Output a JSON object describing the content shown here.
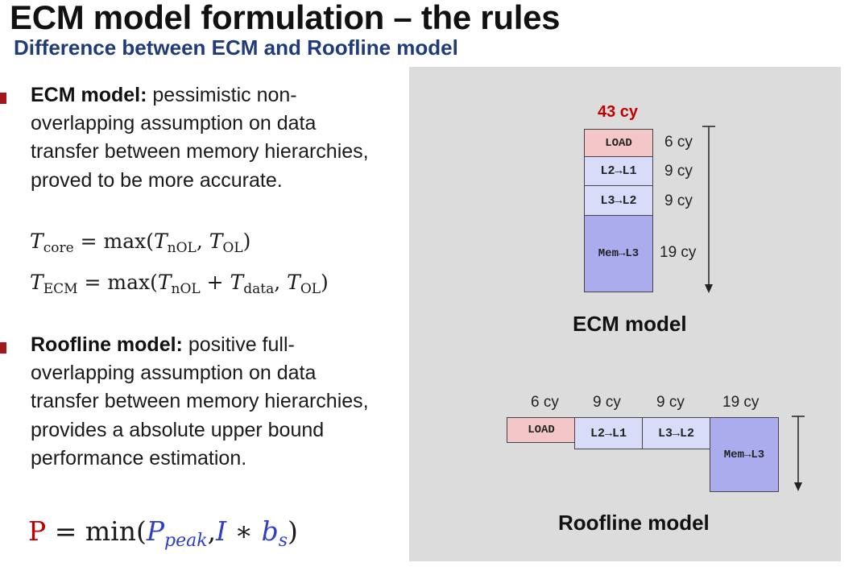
{
  "header": {
    "title": "ECM model formulation – the rules",
    "subtitle": "Difference between ECM and Roofline model"
  },
  "bullets": [
    {
      "term": "ECM model:",
      "text": " pessimistic non-overlapping assumption on data transfer between memory hierarchies, proved to be more accurate."
    },
    {
      "term": "Roofline model:",
      "text": " positive full-overlapping assumption on data transfer between memory hierarchies, provides a absolute upper bound performance estimation."
    }
  ],
  "formulas": {
    "core": {
      "lhs": "T",
      "lhs_sub": "core",
      "eq": " = max(",
      "a": "T",
      "a_sub": "nOL",
      "sep": ", ",
      "b": "T",
      "b_sub": "OL",
      "end": ")"
    },
    "ecm": {
      "lhs": "T",
      "lhs_sub": "ECM",
      "eq": " = max(",
      "a": "T",
      "a_sub": "nOL",
      "plus": " + ",
      "c": "T",
      "c_sub": "data",
      "sep": ", ",
      "b": "T",
      "b_sub": "OL",
      "end": ")"
    },
    "perf": {
      "p": "P",
      "eq": " = min(",
      "a": "P",
      "a_sub": "peak",
      "sep": ",",
      "i": "I",
      "star": " ∗ ",
      "b": "b",
      "b_sub": "s",
      "end": ")"
    }
  },
  "ecm_diagram": {
    "total": "43 cy",
    "blocks": [
      {
        "label": "LOAD",
        "cycles": "6 cy"
      },
      {
        "label": "L2→L1",
        "cycles": "9 cy"
      },
      {
        "label": "L3→L2",
        "cycles": "9 cy"
      },
      {
        "label": "Mem→L3",
        "cycles": "19 cy"
      }
    ],
    "caption": "ECM model"
  },
  "roofline_diagram": {
    "blocks": [
      {
        "label": "LOAD",
        "cycles": "6 cy"
      },
      {
        "label": "L2→L1",
        "cycles": "9 cy"
      },
      {
        "label": "L3→L2",
        "cycles": "9 cy"
      },
      {
        "label": "Mem→L3",
        "cycles": "19 cy"
      }
    ],
    "caption": "Roofline model"
  },
  "colors": {
    "bullet": "#a3161b",
    "subtitle": "#1f3b78",
    "total": "#c00000",
    "load": "#f3c7c8",
    "l2l1": "#d8dcf8",
    "mem": "#aaacee",
    "panel": "#dcdcdc"
  }
}
